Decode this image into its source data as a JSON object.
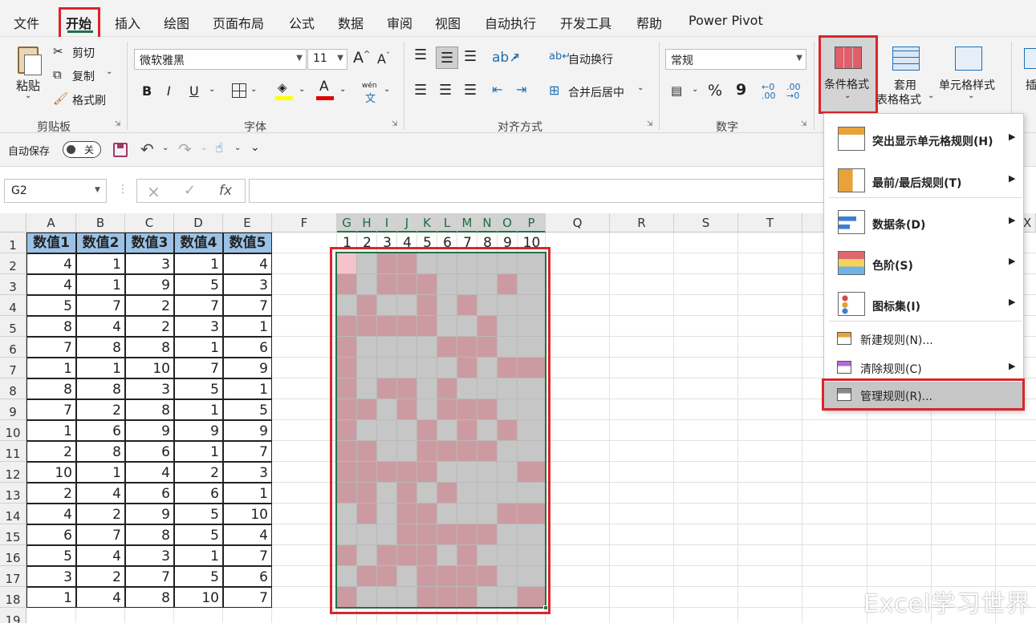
{
  "tabs": [
    "文件",
    "开始",
    "插入",
    "绘图",
    "页面布局",
    "公式",
    "数据",
    "审阅",
    "视图",
    "自动执行",
    "开发工具",
    "帮助",
    "Power Pivot"
  ],
  "clipboard": {
    "paste": "粘贴",
    "cut": "剪切",
    "copy": "复制",
    "format_painter": "格式刷",
    "group": "剪贴板"
  },
  "font": {
    "name": "微软雅黑",
    "size": "11",
    "group": "字体",
    "grow": "A",
    "shrink": "A",
    "bold": "B",
    "italic": "I",
    "underline": "U",
    "wen": "wén",
    "wen_char": "文"
  },
  "align": {
    "wrap": "自动换行",
    "merge": "合并后居中",
    "group": "对齐方式"
  },
  "number": {
    "format": "常规",
    "group": "数字",
    "percent": "%",
    "comma": "9",
    "inc": "←0",
    "dec": ".00"
  },
  "styles": {
    "cond": "条件格式",
    "table_l1": "套用",
    "table_l2": "表格格式",
    "cell_style": "单元格样式",
    "insert": "插"
  },
  "qat": {
    "autosave": "自动保存",
    "off": "关"
  },
  "namebox": "G2",
  "fx": "fx",
  "col_headers": [
    "A",
    "B",
    "C",
    "D",
    "E",
    "F",
    "G",
    "H",
    "I",
    "J",
    "K",
    "L",
    "M",
    "N",
    "O",
    "P",
    "Q",
    "R",
    "S",
    "T"
  ],
  "col_x_label": "X",
  "row_numbers": [
    "1",
    "2",
    "3",
    "4",
    "5",
    "6",
    "7",
    "8",
    "9",
    "10",
    "11",
    "12",
    "13",
    "14",
    "15",
    "16",
    "17",
    "18",
    "19"
  ],
  "table": {
    "headers": [
      "数值1",
      "数值2",
      "数值3",
      "数值4",
      "数值5"
    ],
    "rows": [
      [
        "4",
        "1",
        "3",
        "1",
        "4"
      ],
      [
        "4",
        "1",
        "9",
        "5",
        "3"
      ],
      [
        "5",
        "7",
        "2",
        "7",
        "7"
      ],
      [
        "8",
        "4",
        "2",
        "3",
        "1"
      ],
      [
        "7",
        "8",
        "8",
        "1",
        "6"
      ],
      [
        "1",
        "1",
        "10",
        "7",
        "9"
      ],
      [
        "8",
        "8",
        "3",
        "5",
        "1"
      ],
      [
        "7",
        "2",
        "8",
        "1",
        "5"
      ],
      [
        "1",
        "6",
        "9",
        "9",
        "9"
      ],
      [
        "2",
        "8",
        "6",
        "1",
        "7"
      ],
      [
        "10",
        "1",
        "4",
        "2",
        "3"
      ],
      [
        "2",
        "4",
        "6",
        "6",
        "1"
      ],
      [
        "4",
        "2",
        "9",
        "5",
        "10"
      ],
      [
        "6",
        "7",
        "8",
        "5",
        "4"
      ],
      [
        "5",
        "4",
        "3",
        "1",
        "7"
      ],
      [
        "3",
        "2",
        "7",
        "5",
        "6"
      ],
      [
        "1",
        "4",
        "8",
        "10",
        "7"
      ]
    ]
  },
  "gp_headers": [
    "1",
    "2",
    "3",
    "4",
    "5",
    "6",
    "7",
    "8",
    "9",
    "10"
  ],
  "pattern": [
    "0011000000",
    "1011100010",
    "0100101000",
    "1111100100",
    "1000011100",
    "1000001011",
    "1011010000",
    "1101011100",
    "1000101010",
    "1100111100",
    "1111100001",
    "1101010000",
    "0101100011",
    "0001111100",
    "1011101000",
    "0110111100",
    "1000111001"
  ],
  "colors": {
    "pink": "#cc9ba2",
    "gray": "#c6c6c6",
    "accent_green": "#1e7145",
    "red_box": "#d9262c",
    "selected_cell": "#f5c3cb"
  },
  "menu": {
    "items": [
      {
        "label": "突出显示单元格规则(H)",
        "arrow": true
      },
      {
        "label": "最前/最后规则(T)",
        "arrow": true
      },
      {
        "label": "数据条(D)",
        "arrow": true
      },
      {
        "label": "色阶(S)",
        "arrow": true
      },
      {
        "label": "图标集(I)",
        "arrow": true
      }
    ],
    "new_rule": "新建规则(N)...",
    "clear_rule": "清除规则(C)",
    "manage_rule": "管理规则(R)..."
  },
  "watermark": "Excel学习世界"
}
